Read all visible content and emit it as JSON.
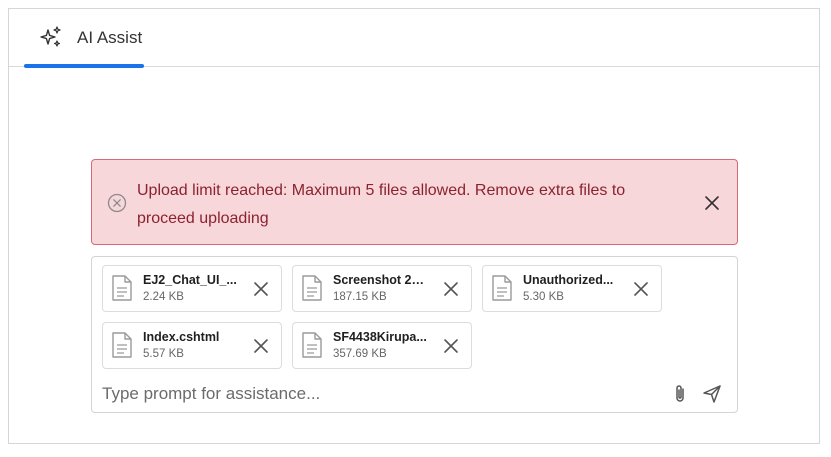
{
  "tabs": [
    {
      "label": "AI Assist",
      "icon": "sparkles-icon",
      "active": true
    }
  ],
  "colors": {
    "accent": "#1a73e8",
    "alert_bg": "#f8d7da",
    "alert_border": "#d46a78",
    "alert_text": "#8b2230"
  },
  "alert": {
    "icon": "error-circle-icon",
    "message": "Upload limit reached: Maximum 5 files allowed. Remove extra files to proceed uploading"
  },
  "attachments": [
    {
      "name": "EJ2_Chat_UI_...",
      "size": "2.24 KB"
    },
    {
      "name": "Screenshot 20...",
      "size": "187.15 KB"
    },
    {
      "name": "Unauthorized...",
      "size": "5.30 KB"
    },
    {
      "name": "Index.cshtml",
      "size": "5.57 KB"
    },
    {
      "name": "SF4438Kirupa...",
      "size": "357.69 KB"
    }
  ],
  "prompt": {
    "placeholder": "Type prompt for assistance...",
    "value": ""
  }
}
